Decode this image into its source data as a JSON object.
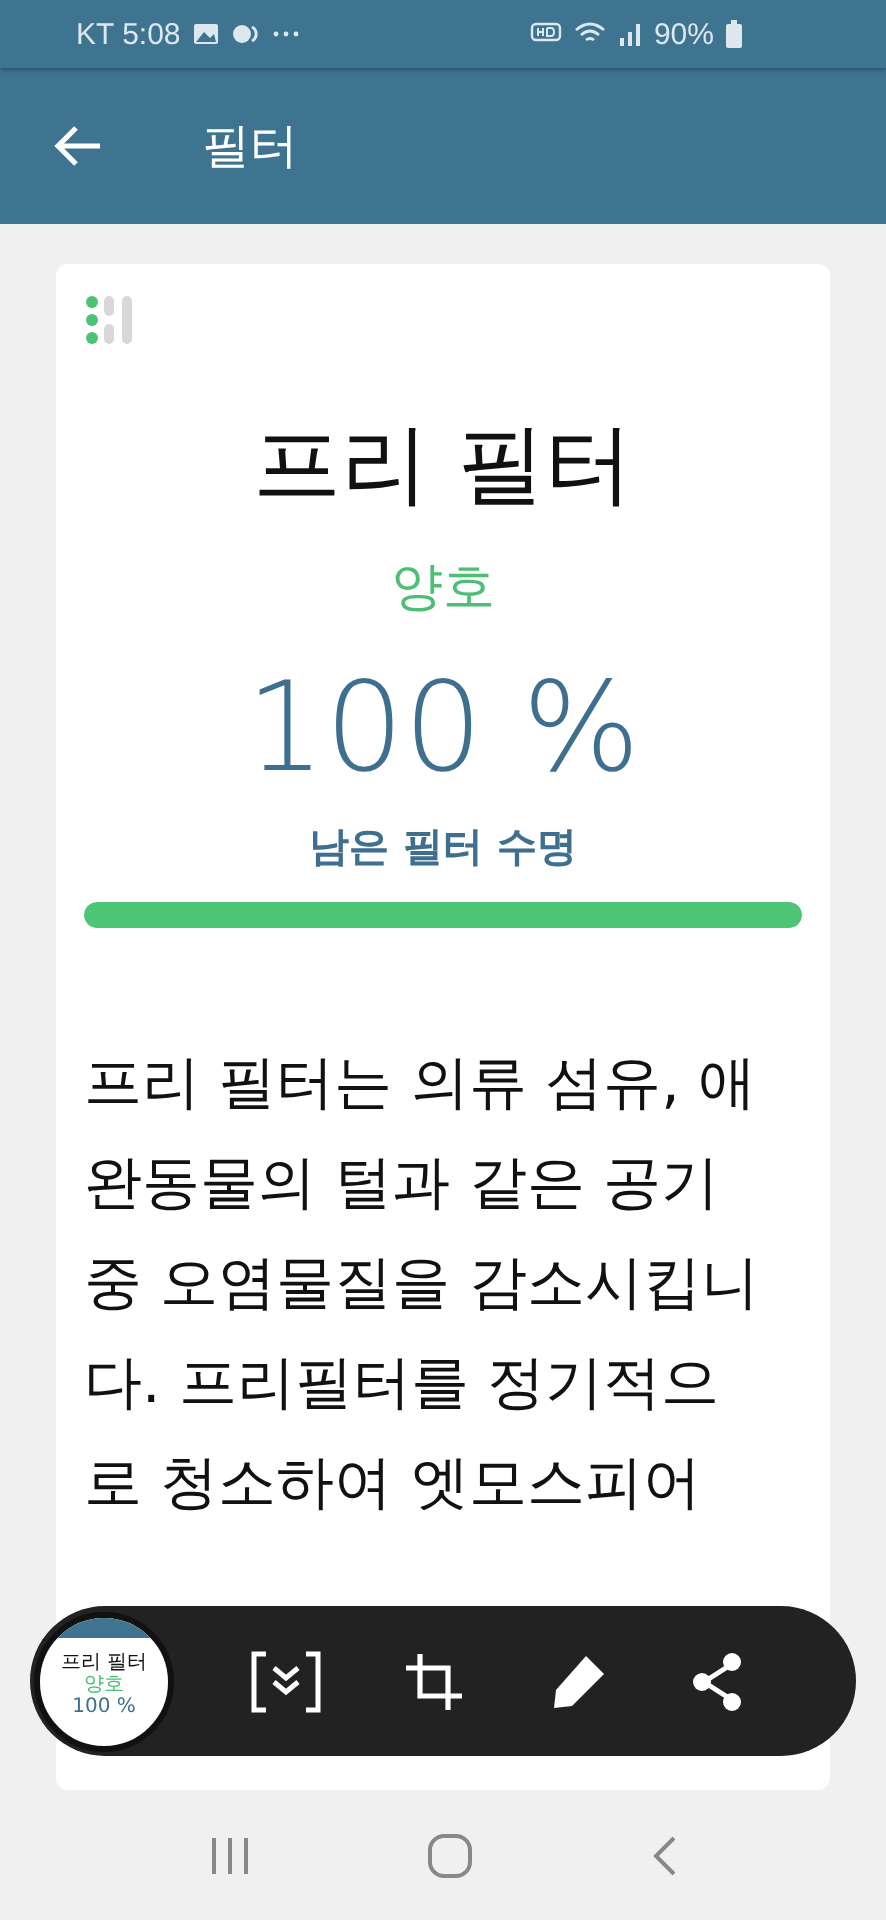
{
  "status_bar": {
    "carrier_time": "KT 5:08",
    "battery": "90%"
  },
  "app_bar": {
    "title": "필터"
  },
  "filter": {
    "name": "프리 필터",
    "status": "양호",
    "percent": "100 %",
    "caption": "남은 필터 수명",
    "level": 1.0,
    "description": "프리 필터는 의류 섬유, 애완동물의 털과 같은 공기 중 오염물질을 감소시킵니다. 프리필터를 정기적으로 청소하여 엣모스피어"
  },
  "capture_toolbar": {
    "thumbnail": {
      "title": "프리 필터",
      "status": "양호",
      "percent": "100 %"
    }
  }
}
